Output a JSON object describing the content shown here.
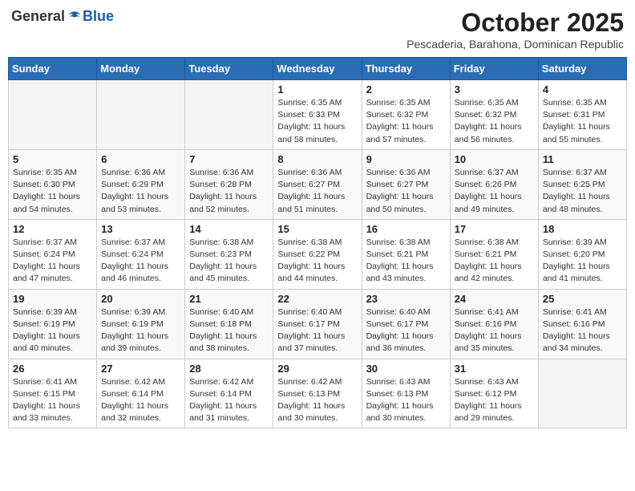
{
  "logo": {
    "general": "General",
    "blue": "Blue"
  },
  "header": {
    "month": "October 2025",
    "location": "Pescaderia, Barahona, Dominican Republic"
  },
  "weekdays": [
    "Sunday",
    "Monday",
    "Tuesday",
    "Wednesday",
    "Thursday",
    "Friday",
    "Saturday"
  ],
  "weeks": [
    [
      {
        "day": "",
        "info": ""
      },
      {
        "day": "",
        "info": ""
      },
      {
        "day": "",
        "info": ""
      },
      {
        "day": "1",
        "info": "Sunrise: 6:35 AM\nSunset: 6:33 PM\nDaylight: 11 hours\nand 58 minutes."
      },
      {
        "day": "2",
        "info": "Sunrise: 6:35 AM\nSunset: 6:32 PM\nDaylight: 11 hours\nand 57 minutes."
      },
      {
        "day": "3",
        "info": "Sunrise: 6:35 AM\nSunset: 6:32 PM\nDaylight: 11 hours\nand 56 minutes."
      },
      {
        "day": "4",
        "info": "Sunrise: 6:35 AM\nSunset: 6:31 PM\nDaylight: 11 hours\nand 55 minutes."
      }
    ],
    [
      {
        "day": "5",
        "info": "Sunrise: 6:35 AM\nSunset: 6:30 PM\nDaylight: 11 hours\nand 54 minutes."
      },
      {
        "day": "6",
        "info": "Sunrise: 6:36 AM\nSunset: 6:29 PM\nDaylight: 11 hours\nand 53 minutes."
      },
      {
        "day": "7",
        "info": "Sunrise: 6:36 AM\nSunset: 6:28 PM\nDaylight: 11 hours\nand 52 minutes."
      },
      {
        "day": "8",
        "info": "Sunrise: 6:36 AM\nSunset: 6:27 PM\nDaylight: 11 hours\nand 51 minutes."
      },
      {
        "day": "9",
        "info": "Sunrise: 6:36 AM\nSunset: 6:27 PM\nDaylight: 11 hours\nand 50 minutes."
      },
      {
        "day": "10",
        "info": "Sunrise: 6:37 AM\nSunset: 6:26 PM\nDaylight: 11 hours\nand 49 minutes."
      },
      {
        "day": "11",
        "info": "Sunrise: 6:37 AM\nSunset: 6:25 PM\nDaylight: 11 hours\nand 48 minutes."
      }
    ],
    [
      {
        "day": "12",
        "info": "Sunrise: 6:37 AM\nSunset: 6:24 PM\nDaylight: 11 hours\nand 47 minutes."
      },
      {
        "day": "13",
        "info": "Sunrise: 6:37 AM\nSunset: 6:24 PM\nDaylight: 11 hours\nand 46 minutes."
      },
      {
        "day": "14",
        "info": "Sunrise: 6:38 AM\nSunset: 6:23 PM\nDaylight: 11 hours\nand 45 minutes."
      },
      {
        "day": "15",
        "info": "Sunrise: 6:38 AM\nSunset: 6:22 PM\nDaylight: 11 hours\nand 44 minutes."
      },
      {
        "day": "16",
        "info": "Sunrise: 6:38 AM\nSunset: 6:21 PM\nDaylight: 11 hours\nand 43 minutes."
      },
      {
        "day": "17",
        "info": "Sunrise: 6:38 AM\nSunset: 6:21 PM\nDaylight: 11 hours\nand 42 minutes."
      },
      {
        "day": "18",
        "info": "Sunrise: 6:39 AM\nSunset: 6:20 PM\nDaylight: 11 hours\nand 41 minutes."
      }
    ],
    [
      {
        "day": "19",
        "info": "Sunrise: 6:39 AM\nSunset: 6:19 PM\nDaylight: 11 hours\nand 40 minutes."
      },
      {
        "day": "20",
        "info": "Sunrise: 6:39 AM\nSunset: 6:19 PM\nDaylight: 11 hours\nand 39 minutes."
      },
      {
        "day": "21",
        "info": "Sunrise: 6:40 AM\nSunset: 6:18 PM\nDaylight: 11 hours\nand 38 minutes."
      },
      {
        "day": "22",
        "info": "Sunrise: 6:40 AM\nSunset: 6:17 PM\nDaylight: 11 hours\nand 37 minutes."
      },
      {
        "day": "23",
        "info": "Sunrise: 6:40 AM\nSunset: 6:17 PM\nDaylight: 11 hours\nand 36 minutes."
      },
      {
        "day": "24",
        "info": "Sunrise: 6:41 AM\nSunset: 6:16 PM\nDaylight: 11 hours\nand 35 minutes."
      },
      {
        "day": "25",
        "info": "Sunrise: 6:41 AM\nSunset: 6:16 PM\nDaylight: 11 hours\nand 34 minutes."
      }
    ],
    [
      {
        "day": "26",
        "info": "Sunrise: 6:41 AM\nSunset: 6:15 PM\nDaylight: 11 hours\nand 33 minutes."
      },
      {
        "day": "27",
        "info": "Sunrise: 6:42 AM\nSunset: 6:14 PM\nDaylight: 11 hours\nand 32 minutes."
      },
      {
        "day": "28",
        "info": "Sunrise: 6:42 AM\nSunset: 6:14 PM\nDaylight: 11 hours\nand 31 minutes."
      },
      {
        "day": "29",
        "info": "Sunrise: 6:42 AM\nSunset: 6:13 PM\nDaylight: 11 hours\nand 30 minutes."
      },
      {
        "day": "30",
        "info": "Sunrise: 6:43 AM\nSunset: 6:13 PM\nDaylight: 11 hours\nand 30 minutes."
      },
      {
        "day": "31",
        "info": "Sunrise: 6:43 AM\nSunset: 6:12 PM\nDaylight: 11 hours\nand 29 minutes."
      },
      {
        "day": "",
        "info": ""
      }
    ]
  ]
}
